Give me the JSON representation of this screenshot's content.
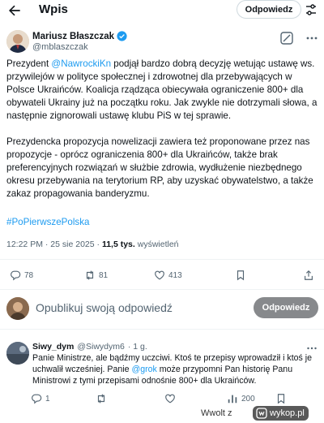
{
  "header": {
    "title": "Wpis",
    "reply_label": "Odpowiedz"
  },
  "tweet": {
    "author": {
      "name": "Mariusz Błaszczak",
      "handle": "@mblaszczak"
    },
    "para1": {
      "before": "Prezydent ",
      "mention": "@NawrockiKn",
      "after": " podjął bardzo dobrą decyzję wetując ustawę ws. przywilejów w polityce społecznej i zdrowotnej dla przebywających w Polsce Ukraińców. Koalicja rządząca obiecywała ograniczenie 800+ dla obywateli Ukrainy już na początku roku. Jak zwykle nie dotrzymali słowa, a następnie zignorowali ustawę klubu PiS w tej sprawie."
    },
    "para2": "Prezydencka propozycja nowelizacji zawiera też proponowane przez nas propozycje - oprócz ograniczenia 800+ dla Ukraińców, także brak preferencyjnych rozwiązań w służbie zdrowia, wydłużenie niezbędnego okresu przebywania na terytorium RP, aby uzyskać obywatelstwo, a także zakaz propagowania banderyzmu.",
    "hashtag": "#PoPierwszePolska",
    "meta": {
      "time": "12:22 PM",
      "sep": " · ",
      "date": "25 sie 2025",
      "views": "11,5 tys.",
      "views_label": " wyświetleń"
    },
    "stats": {
      "replies": "78",
      "reposts": "81",
      "likes": "413"
    }
  },
  "compose": {
    "placeholder": "Opublikuj swoją odpowiedź",
    "button": "Odpowiedz"
  },
  "reply": {
    "name": "Siwy_dym",
    "handle": "@Siwydym6",
    "age": "· 1 g.",
    "text_before": "Panie Ministrze, ale bądźmy uczciwi. Ktoś te przepisy wprowadził i ktoś je uchwalił wcześniej. Panie ",
    "mention": "@grok",
    "text_after": " może przypomni Pan historię Panu Ministrowi z tymi przepisami odnośnie 800+ dla Ukraińców.",
    "stats": {
      "replies": "1",
      "views": "200"
    }
  },
  "watermark": {
    "prefix": "Wwolt",
    "mid": "z",
    "brand": "wykop.pl"
  },
  "colors": {
    "accent": "#1d9bf0",
    "muted": "#536471",
    "button_gray": "#87898c"
  }
}
